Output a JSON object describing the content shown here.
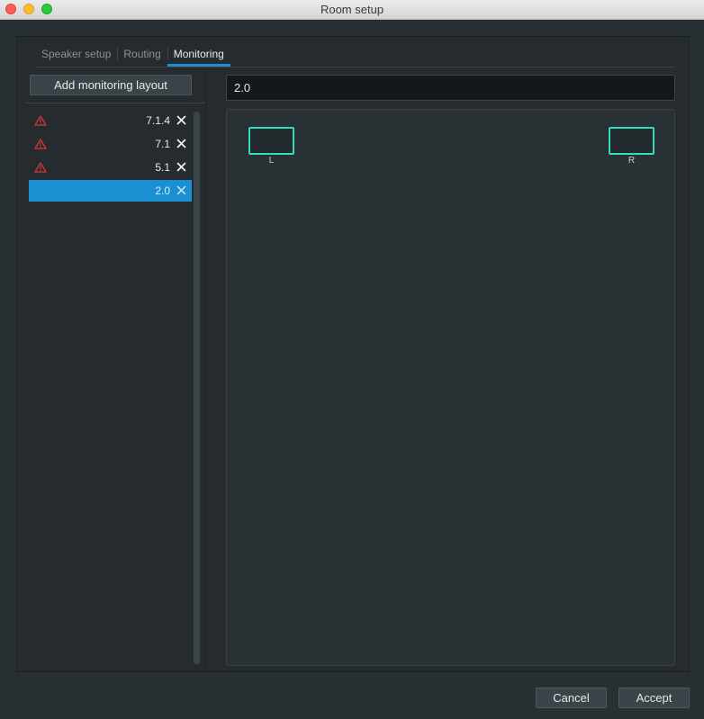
{
  "window": {
    "title": "Room setup"
  },
  "tabs": [
    {
      "label": "Speaker setup",
      "active": false
    },
    {
      "label": "Routing",
      "active": false
    },
    {
      "label": "Monitoring",
      "active": true
    }
  ],
  "monitoring": {
    "add_button_label": "Add monitoring layout",
    "layouts": [
      {
        "label": "7.1.4",
        "warning": true,
        "selected": false
      },
      {
        "label": "7.1",
        "warning": true,
        "selected": false
      },
      {
        "label": "5.1",
        "warning": true,
        "selected": false
      },
      {
        "label": "2.0",
        "warning": false,
        "selected": true
      }
    ],
    "layout_name_value": "2.0",
    "speakers": [
      {
        "label": "L"
      },
      {
        "label": "R"
      }
    ]
  },
  "footer": {
    "cancel_label": "Cancel",
    "accept_label": "Accept"
  },
  "colors": {
    "accent": "#1a8fd2",
    "speaker_outline": "#33dbc1",
    "warning": "#d8333a"
  },
  "icons": {
    "warning": "warning-triangle-icon",
    "delete": "close-icon"
  }
}
